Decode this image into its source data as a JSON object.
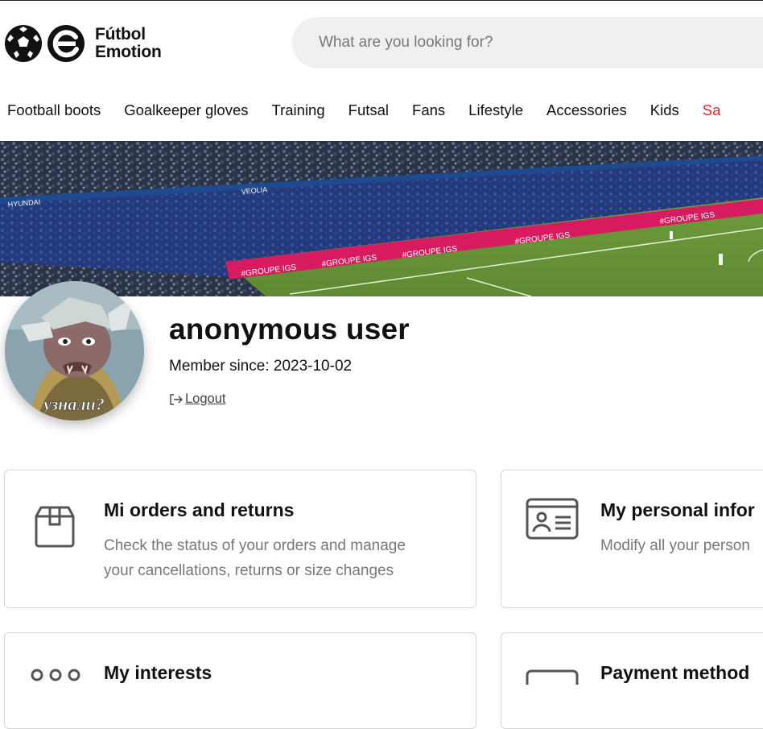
{
  "header": {
    "logo_line1": "Fútbol",
    "logo_line2": "Emotion",
    "search_placeholder": "What are you looking for?"
  },
  "nav": {
    "items": [
      {
        "label": "Football boots"
      },
      {
        "label": "Goalkeeper gloves"
      },
      {
        "label": "Training"
      },
      {
        "label": "Futsal"
      },
      {
        "label": "Fans"
      },
      {
        "label": "Lifestyle"
      },
      {
        "label": "Accessories"
      },
      {
        "label": "Kids"
      },
      {
        "label": "Sa"
      }
    ]
  },
  "banner": {
    "ads": [
      "#GROUPE IGS",
      "HYUNDAI",
      "VEOLIA"
    ]
  },
  "profile": {
    "username": "anonymous user",
    "member_label": "Member since:",
    "member_date": "2023-10-02",
    "logout_label": "Logout",
    "avatar_caption": "узнали?"
  },
  "cards": [
    {
      "title": "Mi orders and returns",
      "desc_line1": "Check the status of your orders and manage",
      "desc_line2": "your cancellations, returns or size changes",
      "icon": "box-icon"
    },
    {
      "title": "My personal infor",
      "desc_line1": "Modify all your person",
      "icon": "id-card-icon"
    },
    {
      "title": "My interests",
      "icon": "dots-icon"
    },
    {
      "title": "Payment method",
      "icon": "card-icon"
    }
  ],
  "colors": {
    "sale": "#e0252b",
    "search_bg": "#f0f0f0",
    "border": "#d6d6d6"
  }
}
